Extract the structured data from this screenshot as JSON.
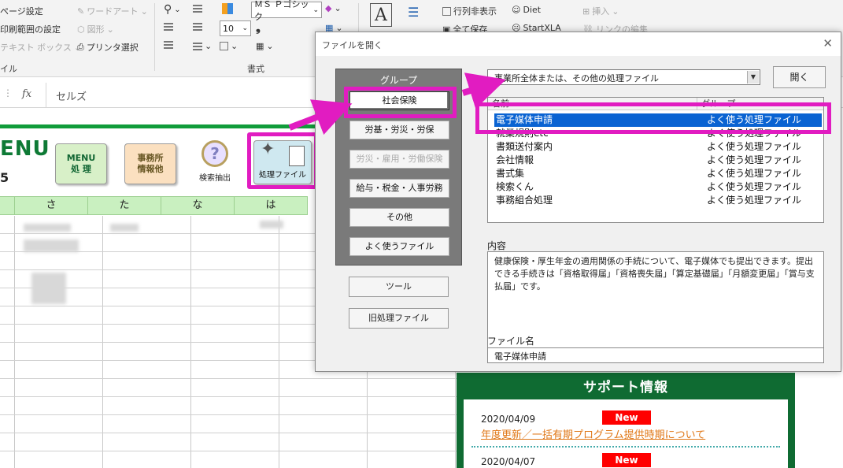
{
  "ribbon": {
    "page_setup": "ページ設定",
    "print_area": "印刷範囲の設定",
    "text_box": "テキスト ボックス",
    "wordart": "ワードアート",
    "shape": "図形",
    "printer_select": "プリンタ選択",
    "group_label_left": "イル",
    "font_name": "ＭＳ Ｐゴシック",
    "font_size": "10",
    "group_label_font": "書式",
    "toggle_columns": "行列非表示",
    "diet": "Diet",
    "insert": "挿入",
    "save_all": "全て保存",
    "startxla": "StartXLA",
    "link_edit": "リンクの編集"
  },
  "formula_bar": {
    "fx": "fx",
    "value": "セルズ"
  },
  "sheet": {
    "menu_title": "ENU",
    "menu_sub": "5",
    "btn_menu": "MENU\n処 理",
    "btn_office": "事務所\n情報他",
    "btn_search": "検索抽出",
    "btn_process": "処理ファイル",
    "columns": [
      "さ",
      "た",
      "な",
      "は"
    ]
  },
  "support": {
    "title": "サポート情報",
    "news": [
      {
        "date": "2020/04/09",
        "badge": "New",
        "link": "年度更新／一括有期プログラム提供時期について"
      },
      {
        "date": "2020/04/07",
        "badge": "New"
      }
    ]
  },
  "dialog": {
    "title": "ファイルを開く",
    "close": "✕",
    "group_label": "グループ",
    "groups": [
      {
        "label": "社会保険",
        "selected": true
      },
      {
        "label": "労基・労災・労保"
      },
      {
        "label": "労災・雇用・労働保険",
        "disabled": true
      },
      {
        "label": "給与・税金・人事労務"
      },
      {
        "label": "その他"
      },
      {
        "label": "よく使うファイル"
      }
    ],
    "tools_button": "ツール",
    "legacy_button": "旧処理ファイル",
    "combo_value": "事業所全体または、その他の処理ファイル",
    "open_button": "開く",
    "list_headers": {
      "name": "名前",
      "group": "グループ"
    },
    "files": [
      {
        "name": "電子媒体申請",
        "group": "よく使う処理ファイル",
        "selected": true
      },
      {
        "name": "就業規則etc",
        "group": "よく使う処理ファイル"
      },
      {
        "name": "書類送付案内",
        "group": "よく使う処理ファイル"
      },
      {
        "name": "会社情報",
        "group": "よく使う処理ファイル"
      },
      {
        "name": "書式集",
        "group": "よく使う処理ファイル"
      },
      {
        "name": "検索くん",
        "group": "よく使う処理ファイル"
      },
      {
        "name": "事務組合処理",
        "group": "よく使う処理ファイル"
      }
    ],
    "content_label": "内容",
    "content_text": "健康保険・厚生年金の適用関係の手続について、電子媒体でも提出できます。提出できる手続きは「資格取得届」「資格喪失届」「算定基礎届」「月額変更届」「賞与支払届」です。",
    "filename_label": "ファイル名",
    "filename_value": "電子媒体申請"
  },
  "colors": {
    "highlight": "#e11cc1",
    "accent_green": "#0f6b32",
    "selection_blue": "#0a63d2"
  }
}
